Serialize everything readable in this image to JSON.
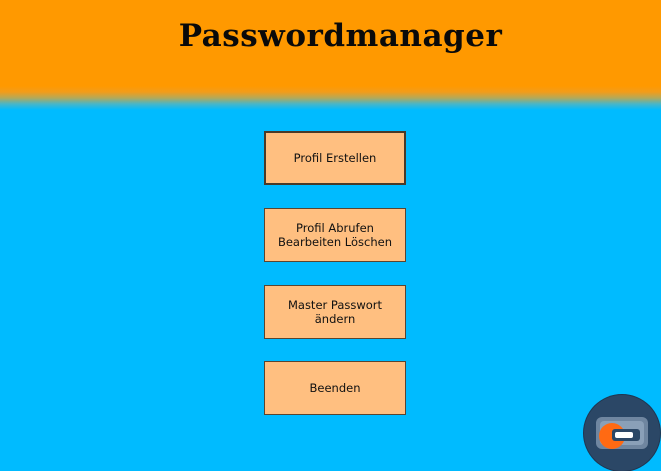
{
  "header": {
    "title": "Passwordmanager"
  },
  "buttons": [
    {
      "label": "Profil Erstellen"
    },
    {
      "label": "Profil Abrufen\nBearbeiten  Löschen"
    },
    {
      "label": "Master Passwort ändern"
    },
    {
      "label": "Beenden"
    }
  ],
  "corner_badge": {
    "icon": "app-logo-icon"
  },
  "colors": {
    "header": "#ff9900",
    "background": "#00bbff",
    "button": "#ffbf80"
  }
}
